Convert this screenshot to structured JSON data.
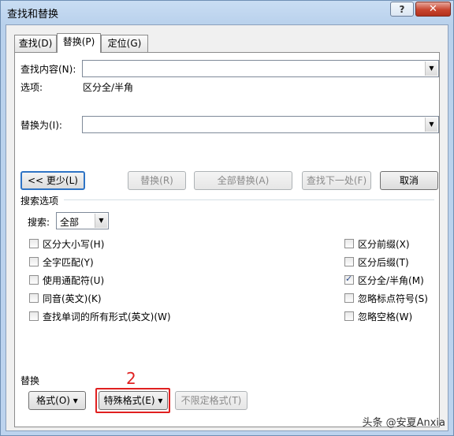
{
  "dialog": {
    "title": "查找和替换",
    "help_label": "?",
    "close_label": "✕"
  },
  "tabs": [
    {
      "label": "查找(D)",
      "active": false
    },
    {
      "label": "替换(P)",
      "active": true
    },
    {
      "label": "定位(G)",
      "active": false
    }
  ],
  "find": {
    "label": "查找内容(N):",
    "value": ""
  },
  "options": {
    "label": "选项:",
    "value": "区分全/半角"
  },
  "replace": {
    "label": "替换为(I):",
    "value": ""
  },
  "buttons": {
    "less": "<< 更少(L)",
    "replace": "替换(R)",
    "replace_all": "全部替换(A)",
    "find_next": "查找下一处(F)",
    "cancel": "取消"
  },
  "search_options": {
    "section_label": "搜索选项",
    "search_label": "搜索:",
    "search_value": "全部",
    "left": [
      {
        "label": "区分大小写(H)",
        "checked": false
      },
      {
        "label": "全字匹配(Y)",
        "checked": false
      },
      {
        "label": "使用通配符(U)",
        "checked": false
      },
      {
        "label": "同音(英文)(K)",
        "checked": false
      },
      {
        "label": "查找单词的所有形式(英文)(W)",
        "checked": false
      }
    ],
    "right": [
      {
        "label": "区分前缀(X)",
        "checked": false
      },
      {
        "label": "区分后缀(T)",
        "checked": false
      },
      {
        "label": "区分全/半角(M)",
        "checked": true
      },
      {
        "label": "忽略标点符号(S)",
        "checked": false
      },
      {
        "label": "忽略空格(W)",
        "checked": false
      }
    ]
  },
  "replace_section": {
    "label": "替换",
    "format": "格式(O) ▾",
    "special": "特殊格式(E) ▾",
    "no_format": "不限定格式(T)"
  },
  "annotation": {
    "step": "2",
    "color": "#e02020"
  },
  "watermark": "头条 @安夏Anxia"
}
